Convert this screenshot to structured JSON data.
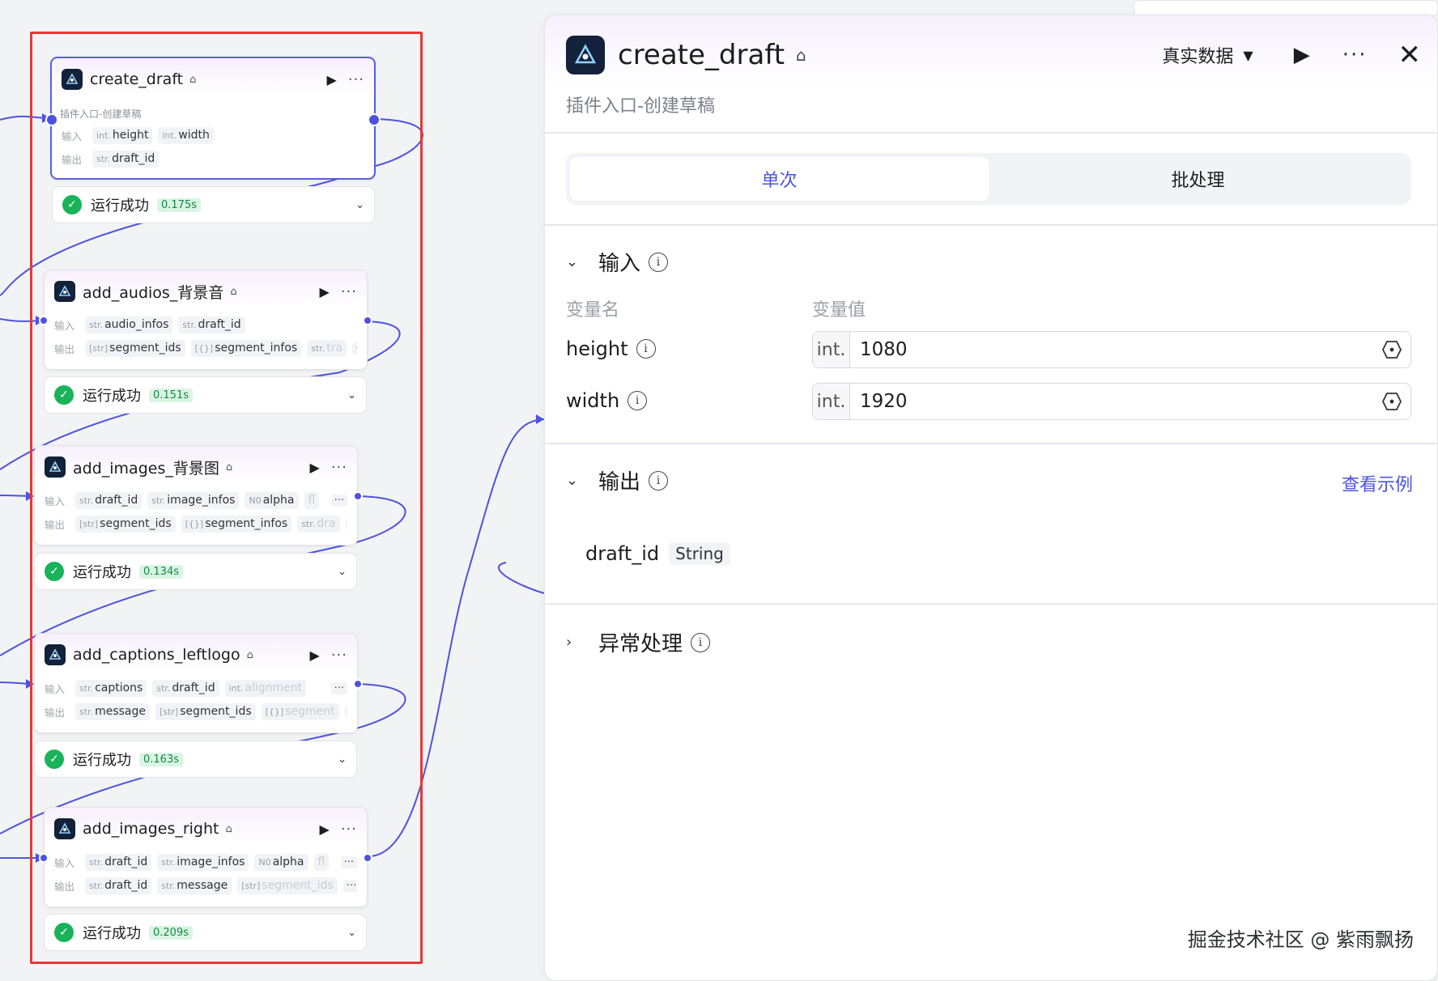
{
  "nodes": [
    {
      "title": "create_draft",
      "description": "插件入口-创建草稿",
      "input_label": "输入",
      "output_label": "输出",
      "inputs": [
        {
          "type": "int.",
          "name": "height"
        },
        {
          "type": "int.",
          "name": "width"
        }
      ],
      "outputs": [
        {
          "type": "str.",
          "name": "draft_id"
        }
      ],
      "status": "运行成功",
      "time": "0.175s"
    },
    {
      "title": "add_audios_背景音",
      "input_label": "输入",
      "output_label": "输出",
      "inputs": [
        {
          "type": "str.",
          "name": "audio_infos"
        },
        {
          "type": "str.",
          "name": "draft_id"
        }
      ],
      "outputs": [
        {
          "type": "[str]",
          "name": "segment_ids"
        },
        {
          "type": "[{}]",
          "name": "segment_infos"
        },
        {
          "type": "str.",
          "name": "tra"
        }
      ],
      "more": "···",
      "status": "运行成功",
      "time": "0.151s"
    },
    {
      "title": "add_images_背景图",
      "input_label": "输入",
      "output_label": "输出",
      "inputs": [
        {
          "type": "str.",
          "name": "draft_id"
        },
        {
          "type": "str.",
          "name": "image_infos"
        },
        {
          "type": "N0",
          "name": "alpha"
        },
        {
          "type": "",
          "name": "fl"
        }
      ],
      "outputs": [
        {
          "type": "[str]",
          "name": "segment_ids"
        },
        {
          "type": "[{}]",
          "name": "segment_infos"
        },
        {
          "type": "str.",
          "name": "dra"
        }
      ],
      "more": "···",
      "status": "运行成功",
      "time": "0.134s"
    },
    {
      "title": "add_captions_leftlogo",
      "input_label": "输入",
      "output_label": "输出",
      "inputs": [
        {
          "type": "str.",
          "name": "captions"
        },
        {
          "type": "str.",
          "name": "draft_id"
        },
        {
          "type": "int.",
          "name": "alignment"
        }
      ],
      "outputs": [
        {
          "type": "str.",
          "name": "message"
        },
        {
          "type": "[str]",
          "name": "segment_ids"
        },
        {
          "type": "[{}]",
          "name": "segment"
        }
      ],
      "more": "···",
      "status": "运行成功",
      "time": "0.163s"
    },
    {
      "title": "add_images_right",
      "input_label": "输入",
      "output_label": "输出",
      "inputs": [
        {
          "type": "str.",
          "name": "draft_id"
        },
        {
          "type": "str.",
          "name": "image_infos"
        },
        {
          "type": "N0",
          "name": "alpha"
        },
        {
          "type": "",
          "name": "fl"
        }
      ],
      "outputs": [
        {
          "type": "str.",
          "name": "draft_id"
        },
        {
          "type": "str.",
          "name": "message"
        },
        {
          "type": "[str]",
          "name": "segment_ids"
        }
      ],
      "more": "···",
      "status": "运行成功",
      "time": "0.209s"
    }
  ],
  "panel": {
    "title": "create_draft",
    "subtitle": "插件入口-创建草稿",
    "data_select": "真实数据",
    "tabs": [
      "单次",
      "批处理"
    ],
    "input_section": "输入",
    "col_name": "变量名",
    "col_value": "变量值",
    "params": [
      {
        "name": "height",
        "type": "int.",
        "value": "1080"
      },
      {
        "name": "width",
        "type": "int.",
        "value": "1920"
      }
    ],
    "output_section": "输出",
    "view_example": "查看示例",
    "output_var": {
      "name": "draft_id",
      "type": "String"
    },
    "error_section": "异常处理"
  },
  "watermark": "掘金技术社区 @ 紫雨飘扬",
  "colors": {
    "accent": "#4d53e0",
    "success": "#19b35a",
    "selection": "#e53935"
  }
}
